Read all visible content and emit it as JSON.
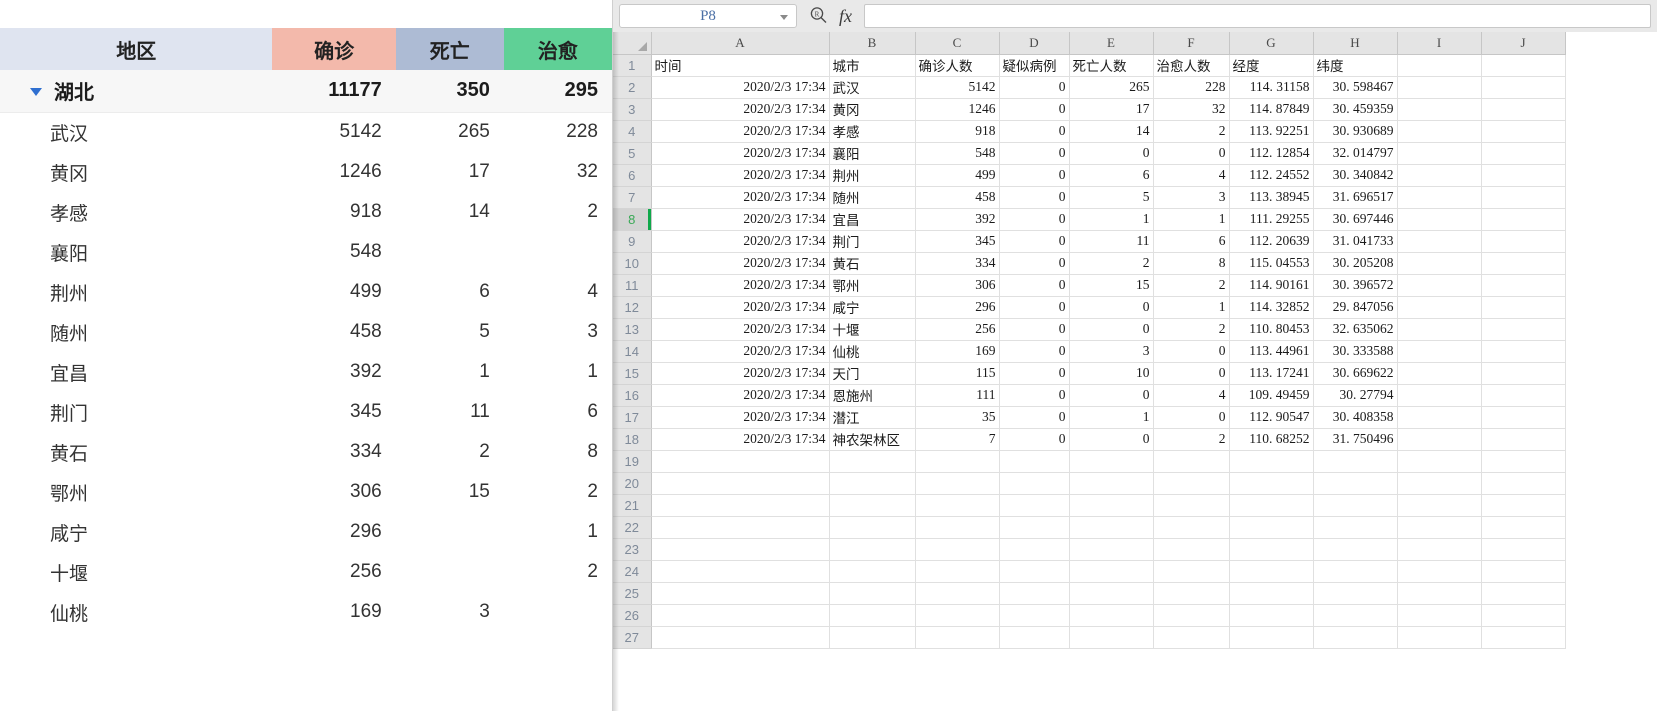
{
  "stats_panel": {
    "headers": {
      "region": "地区",
      "confirmed": "确诊",
      "deaths": "死亡",
      "cured": "治愈"
    },
    "header_colors": {
      "region": "#dfe4f0",
      "confirmed": "#f3b9ab",
      "deaths": "#adbbd4",
      "cured": "#5fd096"
    },
    "total_row": {
      "region": "湖北",
      "confirmed": "11177",
      "deaths": "350",
      "cured": "295",
      "expand_icon": "caret-down-icon"
    },
    "cities": [
      {
        "region": "武汉",
        "confirmed": "5142",
        "deaths": "265",
        "cured": "228"
      },
      {
        "region": "黄冈",
        "confirmed": "1246",
        "deaths": "17",
        "cured": "32"
      },
      {
        "region": "孝感",
        "confirmed": "918",
        "deaths": "14",
        "cured": "2"
      },
      {
        "region": "襄阳",
        "confirmed": "548",
        "deaths": "",
        "cured": ""
      },
      {
        "region": "荆州",
        "confirmed": "499",
        "deaths": "6",
        "cured": "4"
      },
      {
        "region": "随州",
        "confirmed": "458",
        "deaths": "5",
        "cured": "3"
      },
      {
        "region": "宜昌",
        "confirmed": "392",
        "deaths": "1",
        "cured": "1"
      },
      {
        "region": "荆门",
        "confirmed": "345",
        "deaths": "11",
        "cured": "6"
      },
      {
        "region": "黄石",
        "confirmed": "334",
        "deaths": "2",
        "cured": "8"
      },
      {
        "region": "鄂州",
        "confirmed": "306",
        "deaths": "15",
        "cured": "2"
      },
      {
        "region": "咸宁",
        "confirmed": "296",
        "deaths": "",
        "cured": "1"
      },
      {
        "region": "十堰",
        "confirmed": "256",
        "deaths": "",
        "cured": "2"
      },
      {
        "region": "仙桃",
        "confirmed": "169",
        "deaths": "3",
        "cured": ""
      }
    ]
  },
  "spreadsheet": {
    "name_box_value": "P8",
    "formula_value": "",
    "search_icon": "search-icon",
    "function_icon": "fx-icon",
    "column_letters": [
      "A",
      "B",
      "C",
      "D",
      "E",
      "F",
      "G",
      "H",
      "I",
      "J"
    ],
    "active_row": 8,
    "row_numbers": [
      1,
      2,
      3,
      4,
      5,
      6,
      7,
      8,
      9,
      10,
      11,
      12,
      13,
      14,
      15,
      16,
      17,
      18,
      19,
      20,
      21,
      22,
      23,
      24,
      25,
      26,
      27
    ],
    "header_row": [
      "时间",
      "城市",
      "确诊人数",
      "疑似病例",
      "死亡人数",
      "治愈人数",
      "经度",
      "纬度",
      "",
      ""
    ],
    "rows": [
      [
        "2020/2/3  17:34",
        "武汉",
        "5142",
        "0",
        "265",
        "228",
        "114. 31158",
        "30. 598467",
        "",
        ""
      ],
      [
        "2020/2/3  17:34",
        "黄冈",
        "1246",
        "0",
        "17",
        "32",
        "114. 87849",
        "30. 459359",
        "",
        ""
      ],
      [
        "2020/2/3  17:34",
        "孝感",
        "918",
        "0",
        "14",
        "2",
        "113. 92251",
        "30. 930689",
        "",
        ""
      ],
      [
        "2020/2/3  17:34",
        "襄阳",
        "548",
        "0",
        "0",
        "0",
        "112. 12854",
        "32. 014797",
        "",
        ""
      ],
      [
        "2020/2/3  17:34",
        "荆州",
        "499",
        "0",
        "6",
        "4",
        "112. 24552",
        "30. 340842",
        "",
        ""
      ],
      [
        "2020/2/3  17:34",
        "随州",
        "458",
        "0",
        "5",
        "3",
        "113. 38945",
        "31. 696517",
        "",
        ""
      ],
      [
        "2020/2/3  17:34",
        "宜昌",
        "392",
        "0",
        "1",
        "1",
        "111. 29255",
        "30. 697446",
        "",
        ""
      ],
      [
        "2020/2/3  17:34",
        "荆门",
        "345",
        "0",
        "11",
        "6",
        "112. 20639",
        "31. 041733",
        "",
        ""
      ],
      [
        "2020/2/3  17:34",
        "黄石",
        "334",
        "0",
        "2",
        "8",
        "115. 04553",
        "30. 205208",
        "",
        ""
      ],
      [
        "2020/2/3  17:34",
        "鄂州",
        "306",
        "0",
        "15",
        "2",
        "114. 90161",
        "30. 396572",
        "",
        ""
      ],
      [
        "2020/2/3  17:34",
        "咸宁",
        "296",
        "0",
        "0",
        "1",
        "114. 32852",
        "29. 847056",
        "",
        ""
      ],
      [
        "2020/2/3  17:34",
        "十堰",
        "256",
        "0",
        "0",
        "2",
        "110. 80453",
        "32. 635062",
        "",
        ""
      ],
      [
        "2020/2/3  17:34",
        "仙桃",
        "169",
        "0",
        "3",
        "0",
        "113. 44961",
        "30. 333588",
        "",
        ""
      ],
      [
        "2020/2/3  17:34",
        "天门",
        "115",
        "0",
        "10",
        "0",
        "113. 17241",
        "30. 669622",
        "",
        ""
      ],
      [
        "2020/2/3  17:34",
        "恩施州",
        "111",
        "0",
        "0",
        "4",
        "109. 49459",
        "30. 27794",
        "",
        ""
      ],
      [
        "2020/2/3  17:34",
        "潜江",
        "35",
        "0",
        "1",
        "0",
        "112. 90547",
        "30. 408358",
        "",
        ""
      ],
      [
        "2020/2/3  17:34",
        "神农架林区",
        "7",
        "0",
        "0",
        "2",
        "110. 68252",
        "31. 750496",
        "",
        ""
      ]
    ]
  }
}
